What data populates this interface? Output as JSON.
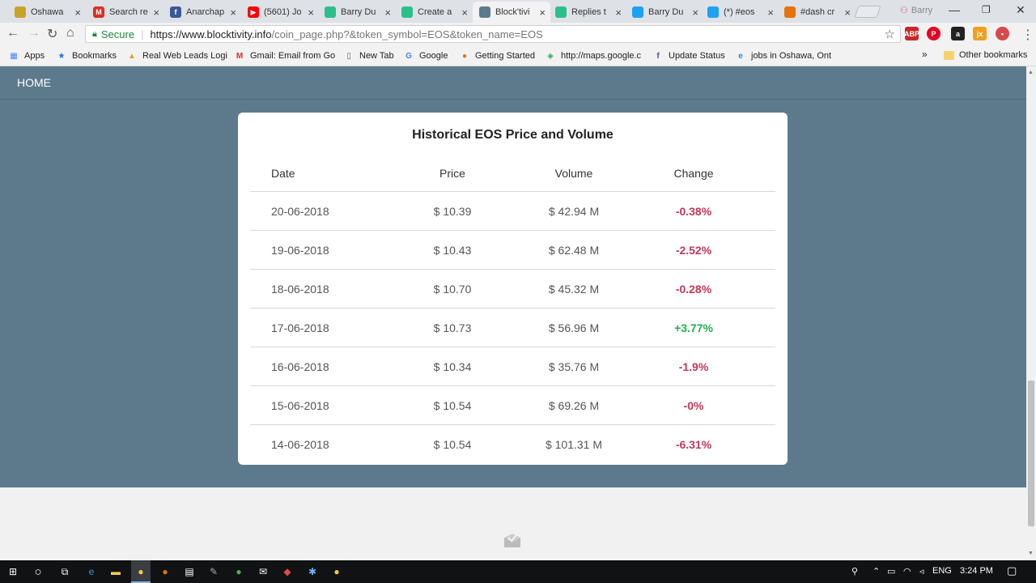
{
  "browser": {
    "tabs": [
      {
        "title": "Oshawa",
        "color": "#c9a227",
        "glyph": ""
      },
      {
        "title": "Search re",
        "color": "#d93025",
        "glyph": "M"
      },
      {
        "title": "Anarchap",
        "color": "#3b5998",
        "glyph": "f"
      },
      {
        "title": "(5601) Jo",
        "color": "#ff0000",
        "glyph": "▶"
      },
      {
        "title": "Barry Du",
        "color": "#2bc08a",
        "glyph": ""
      },
      {
        "title": "Create a",
        "color": "#2bc08a",
        "glyph": ""
      },
      {
        "title": "Block'tivi",
        "color": "#5d7a8c",
        "glyph": "",
        "active": true
      },
      {
        "title": "Replies t",
        "color": "#2bc08a",
        "glyph": ""
      },
      {
        "title": "Barry Du",
        "color": "#1da1f2",
        "glyph": ""
      },
      {
        "title": "(*) #eos",
        "color": "#1da1f2",
        "glyph": ""
      },
      {
        "title": "#dash cr",
        "color": "#e8710a",
        "glyph": ""
      }
    ],
    "profile_name": "Barry",
    "secure_label": "Secure",
    "url_host": "https://www.blocktivity.info",
    "url_path": "/coin_page.php?&token_symbol=EOS&token_name=EOS",
    "bookmarks": [
      {
        "label": "Apps",
        "icon": "apps-grid-icon"
      },
      {
        "label": "Bookmarks",
        "icon": "star-icon"
      },
      {
        "label": "Real Web Leads Logi",
        "icon": "leads-icon"
      },
      {
        "label": "Gmail: Email from Go",
        "icon": "gmail-icon"
      },
      {
        "label": "New Tab",
        "icon": "page-icon"
      },
      {
        "label": "Google",
        "icon": "google-icon"
      },
      {
        "label": "Getting Started",
        "icon": "firefox-icon"
      },
      {
        "label": "http://maps.google.c",
        "icon": "maps-icon"
      },
      {
        "label": "Update Status",
        "icon": "facebook-icon"
      },
      {
        "label": "jobs in Oshawa, Ont",
        "icon": "ie-icon"
      }
    ],
    "bookmarks_overflow": "»",
    "other_bookmarks": "Other bookmarks"
  },
  "nav": {
    "home": "HOME"
  },
  "card": {
    "title": "Historical EOS Price and Volume",
    "headers": {
      "date": "Date",
      "price": "Price",
      "volume": "Volume",
      "change": "Change"
    },
    "rows": [
      {
        "date": "20-06-2018",
        "price": "$ 10.39",
        "volume": "$ 42.94 M",
        "change": "-0.38%"
      },
      {
        "date": "19-06-2018",
        "price": "$ 10.43",
        "volume": "$ 62.48 M",
        "change": "-2.52%"
      },
      {
        "date": "18-06-2018",
        "price": "$ 10.70",
        "volume": "$ 45.32 M",
        "change": "-0.28%"
      },
      {
        "date": "17-06-2018",
        "price": "$ 10.73",
        "volume": "$ 56.96 M",
        "change": "+3.77%"
      },
      {
        "date": "16-06-2018",
        "price": "$ 10.34",
        "volume": "$ 35.76 M",
        "change": "-1.9%"
      },
      {
        "date": "15-06-2018",
        "price": "$ 10.54",
        "volume": "$ 69.26 M",
        "change": "-0%"
      },
      {
        "date": "14-06-2018",
        "price": "$ 10.54",
        "volume": "$ 101.31 M",
        "change": "-6.31%"
      }
    ]
  },
  "colors": {
    "page_bg": "#5d7a8c",
    "negative": "#c0395a",
    "positive": "#22b04b"
  },
  "taskbar": {
    "language": "ENG",
    "time": "3:24 PM"
  }
}
